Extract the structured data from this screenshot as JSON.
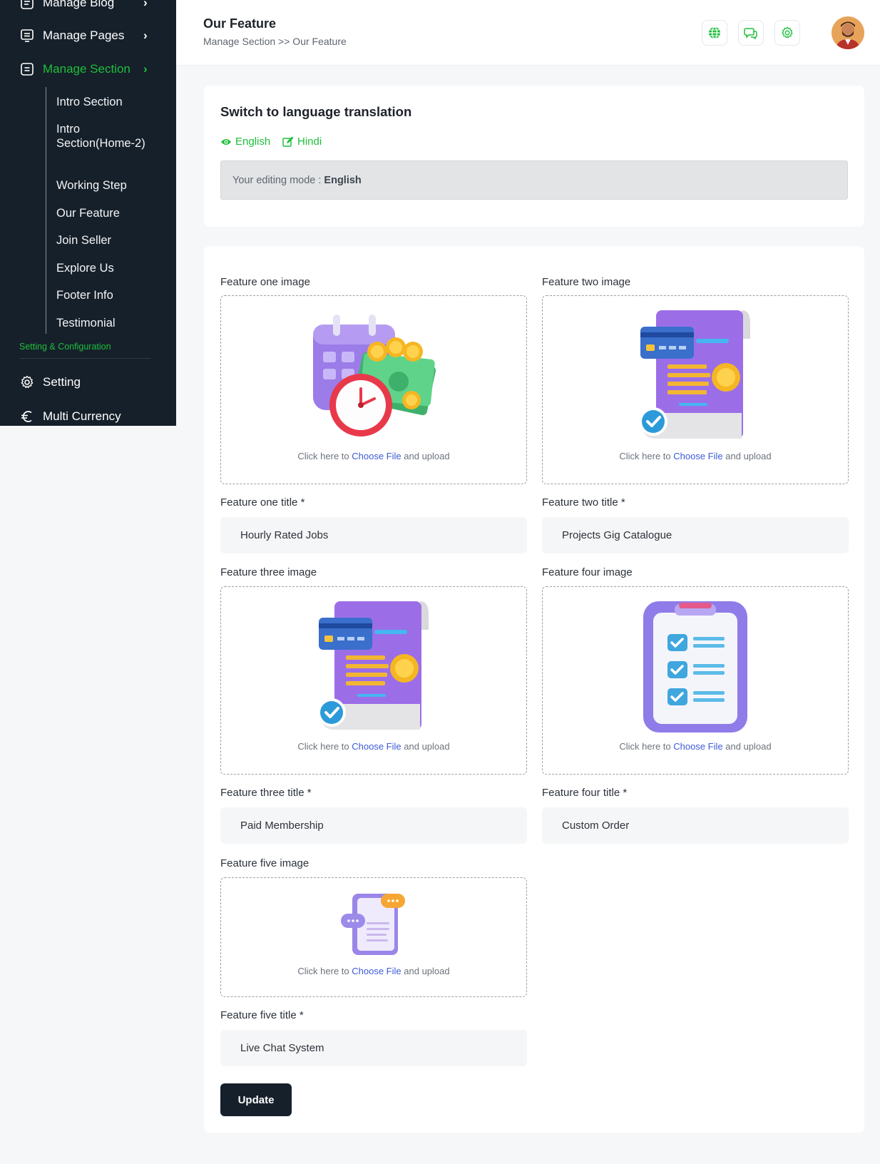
{
  "sidebar": {
    "items": [
      {
        "label": "Manage Blog",
        "icon": "blog-icon"
      },
      {
        "label": "Manage Pages",
        "icon": "pages-icon"
      },
      {
        "label": "Manage Section",
        "icon": "section-icon",
        "active": true
      }
    ],
    "submenu": [
      "Intro Section",
      "Intro Section(Home-2)",
      "Working Step",
      "Our Feature",
      "Join Seller",
      "Explore Us",
      "Footer Info",
      "Testimonial"
    ],
    "section_heading": "Setting & Configuration",
    "settings_items": [
      {
        "label": "Setting",
        "icon": "gear-icon"
      },
      {
        "label": "Multi Currency",
        "icon": "euro-icon"
      }
    ],
    "chevron": "›"
  },
  "header": {
    "title": "Our Feature",
    "breadcrumb": "Manage Section >> Our Feature",
    "icons": [
      "globe-icon",
      "chat-icon",
      "settings-icon"
    ],
    "accent_color": "#1dbf3b"
  },
  "language": {
    "title": "Switch to language translation",
    "options": [
      "English",
      "Hindi"
    ],
    "editing_prefix": "Your editing mode :",
    "editing_value": "English"
  },
  "upload": {
    "hint_before": "Click here to",
    "hint_link": "Choose File",
    "hint_after": "and upload"
  },
  "features": {
    "one_image_label": "Feature one image",
    "two_image_label": "Feature two image",
    "one_title_label": "Feature one title *",
    "two_title_label": "Feature two title *",
    "one_title": "Hourly Rated Jobs",
    "two_title": "Projects Gig Catalogue",
    "three_image_label": "Feature three image",
    "four_image_label": "Feature four image",
    "three_title_label": "Feature three title *",
    "four_title_label": "Feature four title *",
    "three_title": "Paid Membership",
    "four_title": "Custom Order",
    "five_image_label": "Feature five image",
    "five_title_label": "Feature five title *",
    "five_title": "Live Chat System"
  },
  "actions": {
    "update": "Update"
  }
}
